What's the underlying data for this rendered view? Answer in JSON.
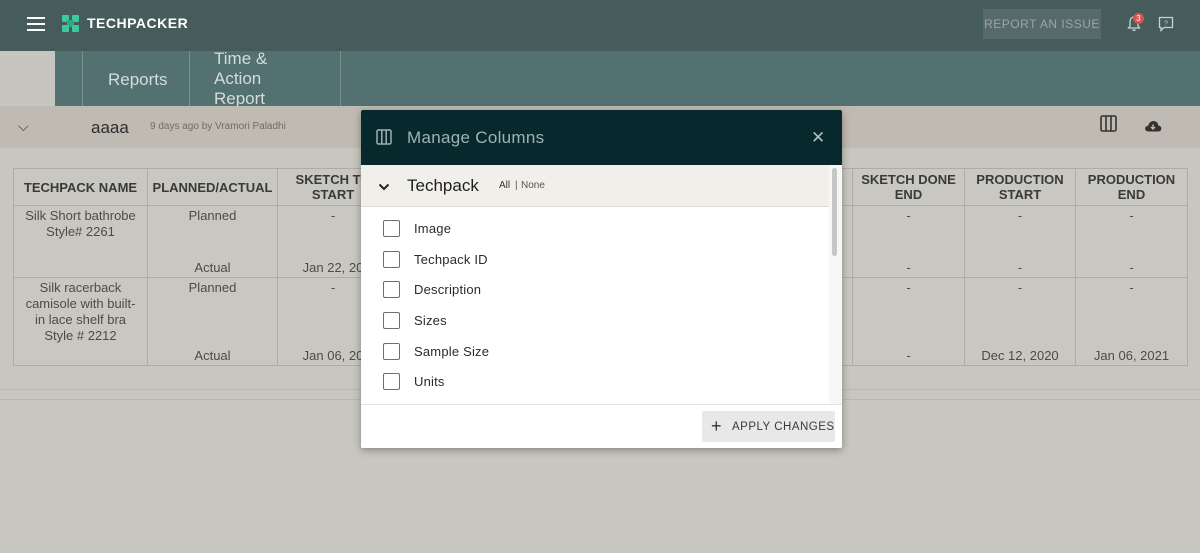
{
  "app": {
    "brand": "TECHPACKER",
    "report_issue": "REPORT AN ISSUE",
    "notification_count": "3",
    "accent": "#3fc79e"
  },
  "subnav": {
    "tabs": [
      {
        "label": "Reports"
      },
      {
        "label": "Time & Action Report"
      }
    ]
  },
  "report": {
    "name": "aaaa",
    "meta": "9 days ago by Vramori Paladhi"
  },
  "table": {
    "headers_left": [
      "TECHPACK NAME",
      "PLANNED/ACTUAL",
      "SKETCH TO START"
    ],
    "headers_right": [
      "SKETCH DONE END",
      "PRODUCTION START",
      "PRODUCTION END"
    ],
    "rows": [
      {
        "name": "Silk Short bathrobe Style# 2261",
        "planned": "Planned",
        "actual": "Actual",
        "sketch_planned": "-",
        "sketch_actual": "Jan 22, 20",
        "sketch_done_planned": "-",
        "sketch_done_actual": "-",
        "prod_start_planned": "-",
        "prod_start_actual": "-",
        "prod_end_planned": "-",
        "prod_end_actual": "-"
      },
      {
        "name": "Silk racerback camisole with built-in lace shelf bra Style # 2212",
        "planned": "Planned",
        "actual": "Actual",
        "sketch_planned": "-",
        "sketch_actual": "Jan 06, 20",
        "sketch_done_planned": "-",
        "sketch_done_actual": "-",
        "prod_start_planned": "-",
        "prod_start_actual": "Dec 12, 2020",
        "prod_end_planned": "-",
        "prod_end_actual": "Jan 06, 2021"
      }
    ]
  },
  "modal": {
    "title": "Manage Columns",
    "section": "Techpack",
    "select_all": "All",
    "separator": "|",
    "select_none": "None",
    "items": [
      {
        "label": "Image",
        "checked": false
      },
      {
        "label": "Techpack ID",
        "checked": false
      },
      {
        "label": "Description",
        "checked": false
      },
      {
        "label": "Sizes",
        "checked": false
      },
      {
        "label": "Sample Size",
        "checked": false
      },
      {
        "label": "Units",
        "checked": false
      }
    ],
    "apply_label": "APPLY CHANGES"
  }
}
